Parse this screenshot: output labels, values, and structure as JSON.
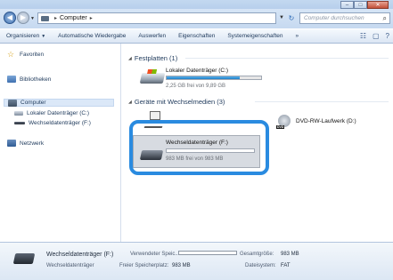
{
  "window": {
    "min_glyph": "–",
    "max_glyph": "□",
    "close_glyph": "✕"
  },
  "address": {
    "back_glyph": "◀",
    "forward_glyph": "▶",
    "sep_glyph": "▸",
    "path": "Computer",
    "path_sep": "▸",
    "refresh_glyph": "↻",
    "search_placeholder": "Computer durchsuchen",
    "search_glyph": "⌕"
  },
  "toolbar": {
    "organize": "Organisieren",
    "autoplay": "Automatische Wiedergabe",
    "eject": "Auswerfen",
    "properties": "Eigenschaften",
    "system_properties": "Systemeigenschaften",
    "more": "»",
    "view_glyph": "☷",
    "preview_glyph": "▢",
    "help_glyph": "?"
  },
  "nav": {
    "favorites": "Favoriten",
    "libraries": "Bibliotheken",
    "computer": "Computer",
    "local_disk": "Lokaler Datenträger (C:)",
    "removable": "Wechseldatenträger (F:)",
    "network": "Netzwerk"
  },
  "content": {
    "group_hdd": "Festplatten (1)",
    "group_removable": "Geräte mit Wechselmedien (3)",
    "drive_c": {
      "name": "Lokaler Datenträger (C:)",
      "free": "2,25 GB frei von 9,89 GB",
      "used_fraction": 0.77
    },
    "dvd": {
      "name": "DVD-RW-Laufwerk (D:)",
      "badge": "DVD"
    },
    "drive_f": {
      "name": "Wechseldatenträger (F:)",
      "free": "983 MB frei von 983 MB",
      "used_fraction": 0.0
    }
  },
  "details": {
    "name": "Wechseldatenträger (F:)",
    "type": "Wechseldatenträger",
    "used_label": "Verwendeter Speic...",
    "free_label": "Freier Speicherplatz:",
    "free_value": "983 MB",
    "total_label": "Gesamtgröße:",
    "total_value": "983 MB",
    "fs_label": "Dateisystem:",
    "fs_value": "FAT"
  },
  "colors": {
    "highlight": "#2a8be0",
    "bar_fill": "#1f7fc7"
  }
}
